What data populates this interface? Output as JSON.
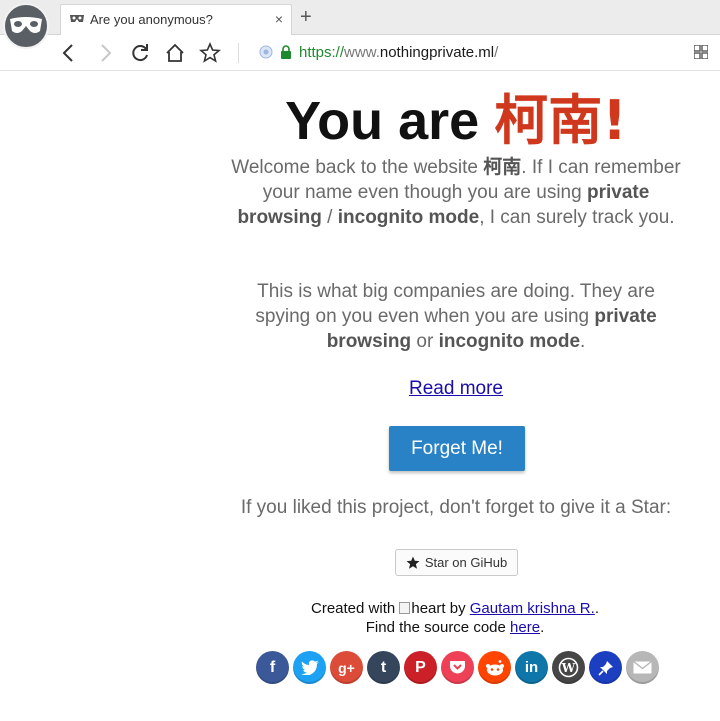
{
  "browser": {
    "tab_title": "Are you anonymous?",
    "new_tab_symbol": "+",
    "close_symbol": "×",
    "url_proto": "https://",
    "url_www": "www.",
    "url_domain": "nothingprivate.ml",
    "url_rest": "/"
  },
  "page": {
    "headline_prefix": "You are ",
    "headline_name": "柯南",
    "headline_suffix": "!",
    "p1": {
      "t1": "Welcome back to the website ",
      "name": "柯南",
      "t2": ". If I can remember your name even though you are using ",
      "b1": "private browsing",
      "t3": " / ",
      "b2": "incognito mode",
      "t4": ", I can surely track you."
    },
    "p2": {
      "t1": "This is what big companies are doing. They are spying on you even when you are using ",
      "b1": "private browsing",
      "t2": " or ",
      "b2": "incognito mode",
      "t3": "."
    },
    "read_more": "Read more",
    "forget_button": "Forget Me!",
    "star_prompt": "If you liked this project, don't forget to give it a Star:",
    "github_button": "Star on GiHub",
    "credit": {
      "created_with": "Created with ",
      "img_alt": "heart",
      "by": " by ",
      "author": "Gautam krishna R.",
      "author_end": ".",
      "find_source": "Find the source code ",
      "here": "here",
      "end": "."
    },
    "social": [
      {
        "name": "facebook-icon",
        "color": "#3b5998",
        "glyph": "f"
      },
      {
        "name": "twitter-icon",
        "color": "#1da1f2",
        "glyph": ""
      },
      {
        "name": "google-plus-icon",
        "color": "#dd4b39",
        "glyph": "g+"
      },
      {
        "name": "tumblr-icon",
        "color": "#35465c",
        "glyph": "t"
      },
      {
        "name": "pinterest-icon",
        "color": "#cb2027",
        "glyph": "P"
      },
      {
        "name": "pocket-icon",
        "color": "#ee4056",
        "glyph": ""
      },
      {
        "name": "reddit-icon",
        "color": "#ff4500",
        "glyph": ""
      },
      {
        "name": "linkedin-icon",
        "color": "#0e76a8",
        "glyph": "in"
      },
      {
        "name": "wordpress-icon",
        "color": "#464646",
        "glyph": "W"
      },
      {
        "name": "pin-icon",
        "color": "#1c3fc2",
        "glyph": ""
      },
      {
        "name": "email-icon",
        "color": "#b7b7b7",
        "glyph": ""
      }
    ]
  }
}
